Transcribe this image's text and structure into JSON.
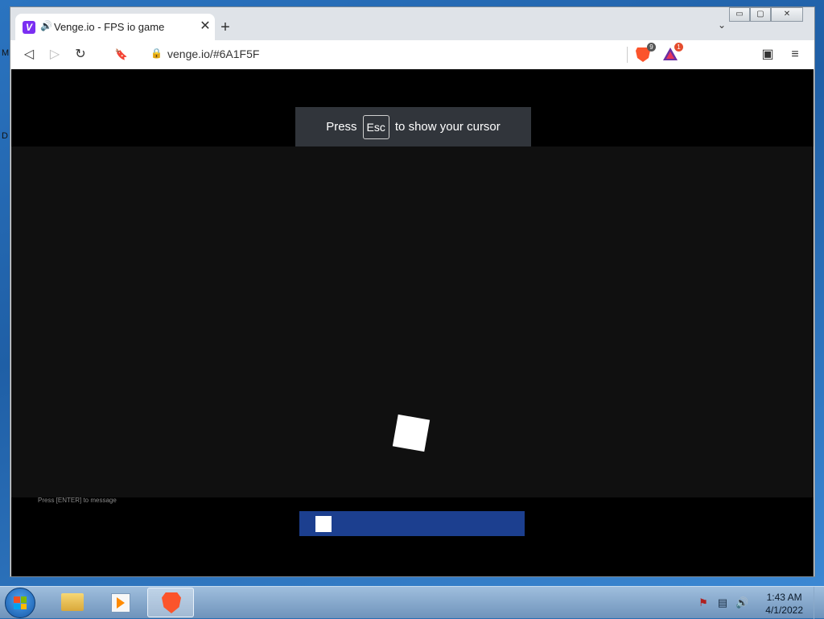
{
  "desktop": {
    "glyph_top": "M",
    "glyph_mid": "D"
  },
  "browser": {
    "tab": {
      "favicon": "V",
      "audio_icon": "🔊",
      "title": "Venge.io - FPS io game",
      "close": "✕"
    },
    "new_tab": "+",
    "tab_list": "⌄",
    "window_controls": {
      "minimize": "▭",
      "maximize": "▢",
      "close": "✕"
    },
    "toolbar": {
      "back": "◁",
      "forward": "▷",
      "reload": "↻",
      "bookmark": "🔖"
    },
    "url": "venge.io/#6A1F5F",
    "shields_count": "9",
    "rewards_count": "1",
    "wallet_icon": "▣",
    "menu_icon": "≡"
  },
  "page": {
    "toast": {
      "prefix": "Press",
      "key": "Esc",
      "suffix": "to show your cursor"
    },
    "chat_hint": "Press [ENTER] to message",
    "loading_progress": 0.07
  },
  "taskbar": {
    "clock_time": "1:43 AM",
    "clock_date": "4/1/2022",
    "tray_icons": [
      "flag-icon",
      "network-icon",
      "volume-icon"
    ]
  },
  "colors": {
    "brand_purple": "#7b2ff2",
    "brave_orange": "#fb542b",
    "load_bar": "#1c3f8f"
  }
}
